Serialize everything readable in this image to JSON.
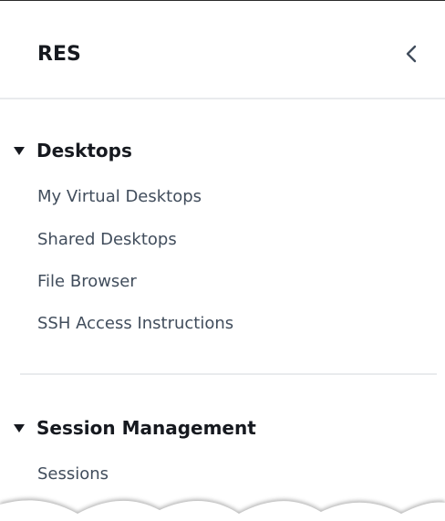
{
  "header": {
    "title": "RES",
    "collapse_icon": "chevron-left-icon"
  },
  "sections": [
    {
      "label": "Desktops",
      "expanded": true,
      "items": [
        {
          "label": "My Virtual Desktops"
        },
        {
          "label": "Shared Desktops"
        },
        {
          "label": "File Browser"
        },
        {
          "label": "SSH Access Instructions"
        }
      ]
    },
    {
      "label": "Session Management",
      "expanded": true,
      "items": [
        {
          "label": "Sessions"
        }
      ]
    }
  ],
  "colors": {
    "heading": "#16191f",
    "link": "#414d5c",
    "divider": "#e9ebed"
  }
}
